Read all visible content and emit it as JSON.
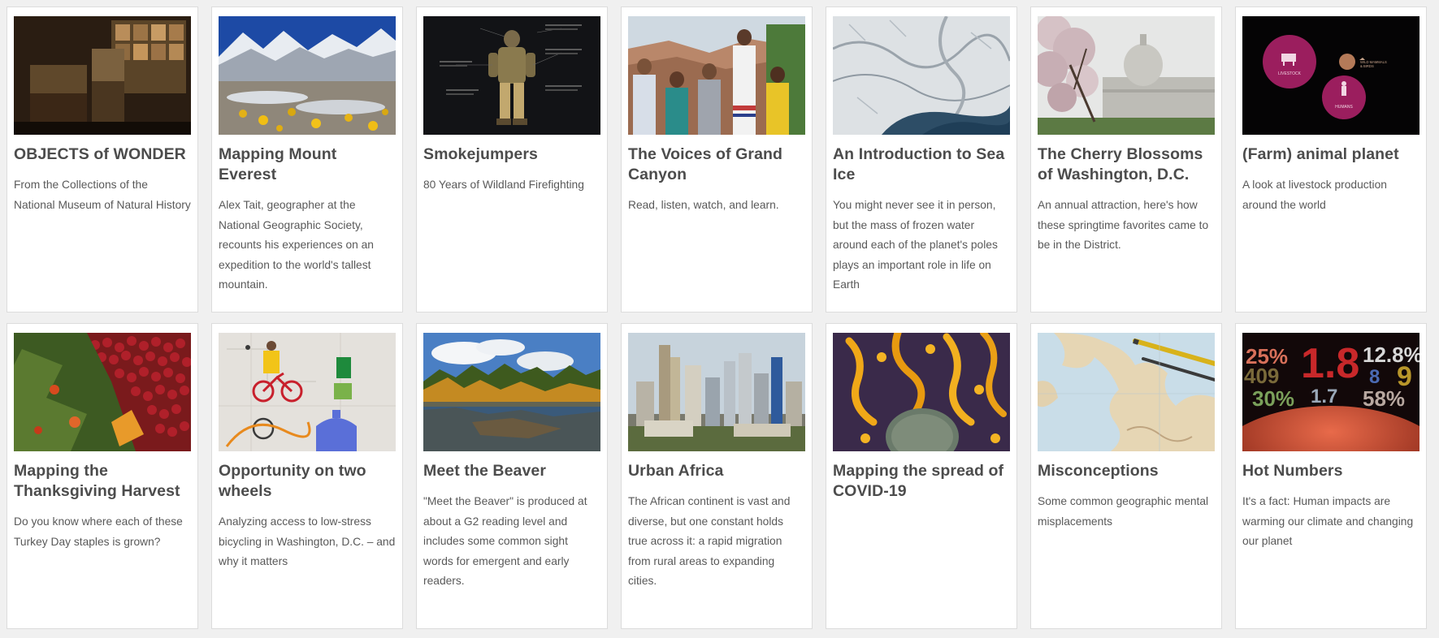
{
  "cards": [
    {
      "title": "OBJECTS of WONDER",
      "description": "From the Collections of the National Museum of Natural History",
      "thumbnail": "museum-display-case-photo"
    },
    {
      "title": "Mapping Mount Everest",
      "description": "Alex Tait, geographer at the National Geographic Society, recounts his experiences on an expedition to the world's tallest mountain.",
      "thumbnail": "everest-base-camp-photo"
    },
    {
      "title": "Smokejumpers",
      "description": "80 Years of Wildland Firefighting",
      "thumbnail": "smokejumper-gear-diagram"
    },
    {
      "title": "The Voices of Grand Canyon",
      "description": "Read, listen, watch, and learn.",
      "thumbnail": "grand-canyon-people-photo"
    },
    {
      "title": "An Introduction to Sea Ice",
      "description": "You might never see it in person, but the mass of frozen water around each of the planet's poles plays an important role in life on Earth",
      "thumbnail": "sea-ice-satellite-photo"
    },
    {
      "title": "The Cherry Blossoms of Washington, D.C.",
      "description": "An annual attraction, here's how these springtime favorites came to be in the District.",
      "thumbnail": "capitol-cherry-blossom-photo"
    },
    {
      "title": "(Farm) animal planet",
      "description": "A look at livestock production around the world",
      "thumbnail": "livestock-bubble-graphic",
      "thumb_labels": {
        "livestock": "LIVESTOCK",
        "wild_1": "WILD MAMMALS",
        "wild_2": "& BIRDS",
        "humans": "HUMANS"
      }
    },
    {
      "title": "Mapping the Thanksgiving Harvest",
      "description": "Do you know where each of these Turkey Day staples is grown?",
      "thumbnail": "cranberry-harvest-photo"
    },
    {
      "title": "Opportunity on two wheels",
      "description": "Analyzing access to low-stress bicycling in Washington, D.C. – and why it matters",
      "thumbnail": "bicycling-collage"
    },
    {
      "title": "Meet the Beaver",
      "description": "\"Meet the Beaver\" is produced at about a G2 reading level and includes some common sight words for emergent and early readers.",
      "thumbnail": "beaver-pond-photo"
    },
    {
      "title": "Urban Africa",
      "description": "The African continent is vast and diverse, but one constant holds true across it: a rapid migration from rural areas to expanding cities.",
      "thumbnail": "african-city-skyline-photo"
    },
    {
      "title": "Mapping the spread of COVID-19",
      "description": "",
      "thumbnail": "coronavirus-microscope-image"
    },
    {
      "title": "Misconceptions",
      "description": "Some common geographic mental misplacements",
      "thumbnail": "europe-map-with-pencils"
    },
    {
      "title": "Hot Numbers",
      "description": "It's a fact: Human impacts are warming our climate and changing our planet",
      "thumbnail": "hot-numbers-graphic",
      "thumb_numbers": {
        "n1": "25%",
        "n2": "1.8",
        "n3": "12.8%",
        "n4": "409",
        "n5": "8",
        "n6": "9",
        "n7": "30%",
        "n8": "1.7",
        "n9": "58%"
      }
    }
  ],
  "colors": {
    "page_background": "#f0f0f0",
    "card_background": "#ffffff",
    "card_border": "#dcdcdc",
    "title_text": "#4c4c4c",
    "description_text": "#595959"
  }
}
